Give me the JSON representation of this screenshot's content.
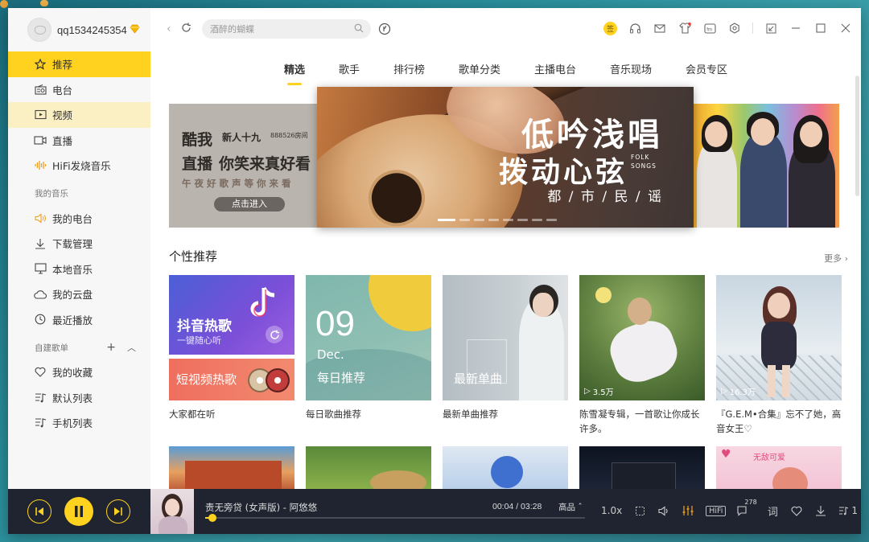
{
  "user": {
    "name": "qq1534245354"
  },
  "sidebar": {
    "items": [
      {
        "label": "推荐",
        "icon": "star-icon"
      },
      {
        "label": "电台",
        "icon": "radio-icon"
      },
      {
        "label": "视频",
        "icon": "video-icon"
      },
      {
        "label": "直播",
        "icon": "live-icon"
      },
      {
        "label": "HiFi发烧音乐",
        "icon": "hifi-wave-icon"
      }
    ],
    "my_music_title": "我的音乐",
    "my_music": [
      {
        "label": "我的电台",
        "icon": "speaker-icon"
      },
      {
        "label": "下载管理",
        "icon": "download-icon"
      },
      {
        "label": "本地音乐",
        "icon": "monitor-icon"
      },
      {
        "label": "我的云盘",
        "icon": "cloud-icon"
      },
      {
        "label": "最近播放",
        "icon": "clock-icon"
      }
    ],
    "playlists_title": "自建歌单",
    "playlists": [
      {
        "label": "我的收藏",
        "icon": "heart-icon"
      },
      {
        "label": "默认列表",
        "icon": "music-list-icon"
      },
      {
        "label": "手机列表",
        "icon": "music-list-icon"
      }
    ]
  },
  "search": {
    "placeholder": "酒醉的蝴蝶"
  },
  "tabs": [
    "精选",
    "歌手",
    "排行榜",
    "歌单分类",
    "主播电台",
    "音乐现场",
    "会员专区"
  ],
  "banner": {
    "left": {
      "line1a": "酷我",
      "line1b": "新人十九",
      "line1c": "888526房间",
      "line2a": "直播",
      "line2b": "你笑来真好看",
      "line3": "午夜好歌声等你来看",
      "button": "点击进入"
    },
    "center": {
      "title1": "低吟浅唱",
      "title2": "拨动心弦",
      "folk": "FOLK SONGS",
      "subtitle": "都 / 市 / 民 / 谣"
    }
  },
  "section": {
    "title": "个性推荐",
    "more": "更多 ›"
  },
  "cards": [
    {
      "caption": "大家都在听",
      "top_label": "抖音热歌",
      "top_sub": "一键随心听",
      "bottom_label": "短视频热歌"
    },
    {
      "caption": "每日歌曲推荐",
      "day": "09",
      "month": "Dec.",
      "label": "每日推荐"
    },
    {
      "caption": "最新单曲推荐",
      "label": "最新单曲"
    },
    {
      "caption": "陈雪凝专辑，一首歌让你成长许多。",
      "plays": "3.5万"
    },
    {
      "caption": "『G.E.M•合集』忘不了她，高音女王♡",
      "plays": "16.3万"
    }
  ],
  "row2_label": "无敌可爱",
  "player": {
    "song": "责无旁贷 (女声版) - 阿悠悠",
    "time": "00:04 / 03:28",
    "quality": "高品 ˆ",
    "speed": "1.0x",
    "hifi": "HiFi",
    "comments": "278",
    "lyrics": "词",
    "playlist_count": "1",
    "progress": 0.02
  },
  "colors": {
    "accent": "#ffd21f",
    "player_bg": "#1f2430",
    "sidebar_bg": "#f7f7f7"
  }
}
